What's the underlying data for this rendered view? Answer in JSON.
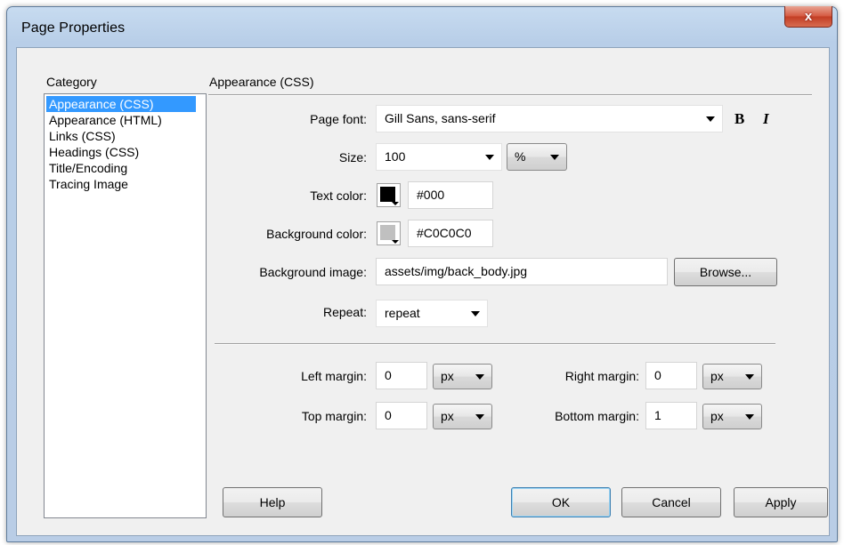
{
  "window": {
    "title": "Page Properties",
    "close_symbol": "x"
  },
  "category": {
    "heading": "Category",
    "items": [
      {
        "label": "Appearance (CSS)",
        "selected": true
      },
      {
        "label": "Appearance (HTML)"
      },
      {
        "label": "Links (CSS)"
      },
      {
        "label": "Headings (CSS)"
      },
      {
        "label": "Title/Encoding"
      },
      {
        "label": "Tracing Image"
      }
    ]
  },
  "section_title": "Appearance (CSS)",
  "page_font": {
    "label": "Page font:",
    "value": "Gill Sans, sans-serif",
    "bold": "B",
    "italic": "I"
  },
  "size": {
    "label": "Size:",
    "value": "100",
    "unit": "%"
  },
  "text_color": {
    "label": "Text color:",
    "value": "#000",
    "swatch": "#000000"
  },
  "background_color": {
    "label": "Background color:",
    "value": "#C0C0C0",
    "swatch": "#C0C0C0"
  },
  "background_image": {
    "label": "Background image:",
    "value": "assets/img/back_body.jpg",
    "browse": "Browse..."
  },
  "repeat": {
    "label": "Repeat:",
    "value": "repeat"
  },
  "margins": {
    "left": {
      "label": "Left margin:",
      "value": "0",
      "unit": "px"
    },
    "right": {
      "label": "Right margin:",
      "value": "0",
      "unit": "px"
    },
    "top": {
      "label": "Top margin:",
      "value": "0",
      "unit": "px"
    },
    "bottom": {
      "label": "Bottom margin:",
      "value": "1",
      "unit": "px"
    }
  },
  "buttons": {
    "help": "Help",
    "ok": "OK",
    "cancel": "Cancel",
    "apply": "Apply"
  },
  "icons": [
    "close-icon",
    "chevron-down-icon",
    "color-swatch-icon"
  ]
}
